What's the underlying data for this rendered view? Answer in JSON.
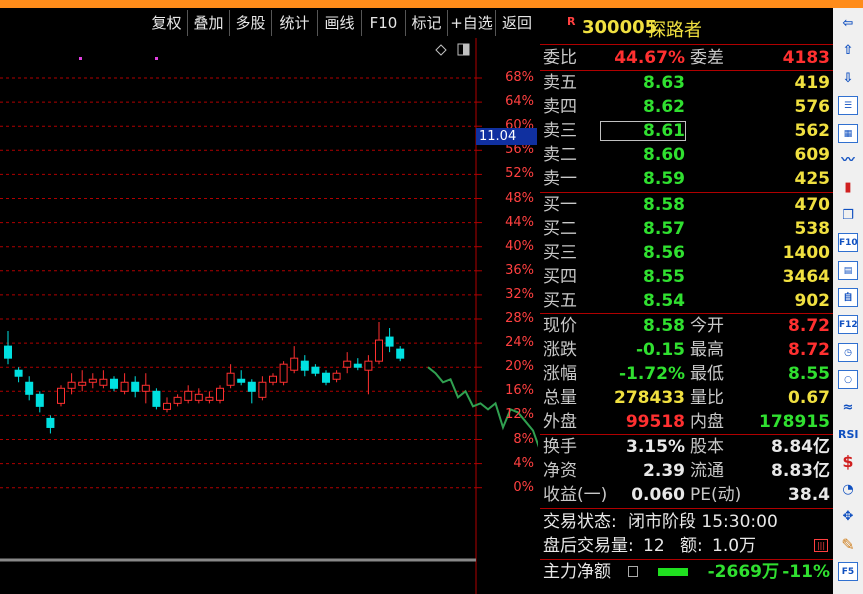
{
  "toolbar": {
    "buttons": [
      "复权",
      "叠加",
      "多股",
      "统计",
      "画线",
      "F10",
      "标记",
      "+自选",
      "返回"
    ]
  },
  "chart": {
    "axis_labels": [
      "68%",
      "64%",
      "60%",
      "56%",
      "52%",
      "48%",
      "44%",
      "40%",
      "36%",
      "32%",
      "28%",
      "24%",
      "20%",
      "16%",
      "12%",
      "8%",
      "4%",
      "0%"
    ],
    "price_tag": "11.04",
    "colors": {
      "up": "#ff3030",
      "down": "#00e0e0",
      "grid": "#b00000",
      "annotation": "#30a050"
    }
  },
  "chart_data": {
    "type": "candlestick",
    "title": "",
    "ylabel": "",
    "y_axis_unit": "percent",
    "ylim": [
      0,
      68
    ],
    "candles_pct": [
      {
        "o": 23.5,
        "c": 21.5,
        "h": 26.0,
        "l": 20.5
      },
      {
        "o": 19.5,
        "c": 18.5,
        "h": 20.0,
        "l": 17.5
      },
      {
        "o": 17.5,
        "c": 15.5,
        "h": 18.5,
        "l": 14.5
      },
      {
        "o": 15.5,
        "c": 13.5,
        "h": 16.0,
        "l": 12.5
      },
      {
        "o": 11.5,
        "c": 10.0,
        "h": 12.0,
        "l": 9.0
      },
      {
        "o": 14.0,
        "c": 16.5,
        "h": 17.0,
        "l": 13.5
      },
      {
        "o": 16.5,
        "c": 17.5,
        "h": 19.0,
        "l": 15.5
      },
      {
        "o": 17.0,
        "c": 17.5,
        "h": 19.5,
        "l": 16.0
      },
      {
        "o": 17.5,
        "c": 18.0,
        "h": 19.0,
        "l": 16.5
      },
      {
        "o": 17.0,
        "c": 18.0,
        "h": 19.5,
        "l": 16.5
      },
      {
        "o": 18.0,
        "c": 16.5,
        "h": 18.5,
        "l": 16.0
      },
      {
        "o": 16.0,
        "c": 17.5,
        "h": 19.0,
        "l": 15.5
      },
      {
        "o": 17.5,
        "c": 16.0,
        "h": 18.5,
        "l": 15.0
      },
      {
        "o": 16.0,
        "c": 17.0,
        "h": 19.0,
        "l": 14.0
      },
      {
        "o": 16.0,
        "c": 13.5,
        "h": 16.5,
        "l": 13.0
      },
      {
        "o": 13.0,
        "c": 14.0,
        "h": 15.0,
        "l": 12.5
      },
      {
        "o": 14.0,
        "c": 15.0,
        "h": 15.5,
        "l": 13.5
      },
      {
        "o": 14.5,
        "c": 16.0,
        "h": 17.0,
        "l": 14.0
      },
      {
        "o": 14.5,
        "c": 15.5,
        "h": 16.5,
        "l": 14.0
      },
      {
        "o": 14.5,
        "c": 15.0,
        "h": 16.0,
        "l": 14.0
      },
      {
        "o": 14.5,
        "c": 16.5,
        "h": 17.0,
        "l": 14.0
      },
      {
        "o": 17.0,
        "c": 19.0,
        "h": 20.5,
        "l": 16.5
      },
      {
        "o": 18.0,
        "c": 17.5,
        "h": 19.5,
        "l": 17.0
      },
      {
        "o": 17.5,
        "c": 16.0,
        "h": 18.0,
        "l": 14.0
      },
      {
        "o": 15.0,
        "c": 17.5,
        "h": 18.5,
        "l": 14.5
      },
      {
        "o": 17.5,
        "c": 18.5,
        "h": 19.0,
        "l": 17.0
      },
      {
        "o": 17.5,
        "c": 20.5,
        "h": 21.0,
        "l": 17.0
      },
      {
        "o": 19.5,
        "c": 21.5,
        "h": 23.5,
        "l": 19.0
      },
      {
        "o": 21.0,
        "c": 19.5,
        "h": 22.0,
        "l": 18.5
      },
      {
        "o": 20.0,
        "c": 19.0,
        "h": 20.5,
        "l": 18.5
      },
      {
        "o": 19.0,
        "c": 17.5,
        "h": 19.5,
        "l": 17.0
      },
      {
        "o": 18.0,
        "c": 19.0,
        "h": 19.5,
        "l": 17.5
      },
      {
        "o": 20.0,
        "c": 21.0,
        "h": 22.5,
        "l": 19.0
      },
      {
        "o": 20.5,
        "c": 20.0,
        "h": 21.5,
        "l": 19.5
      },
      {
        "o": 19.5,
        "c": 21.0,
        "h": 22.0,
        "l": 15.5
      },
      {
        "o": 21.0,
        "c": 24.5,
        "h": 27.5,
        "l": 20.5
      },
      {
        "o": 25.0,
        "c": 23.5,
        "h": 26.5,
        "l": 22.5
      },
      {
        "o": 23.0,
        "c": 21.5,
        "h": 23.5,
        "l": 21.0
      }
    ],
    "annotation_line_pct": [
      [
        20.0,
        0
      ],
      [
        19.0,
        1
      ],
      [
        17.5,
        2
      ],
      [
        18.0,
        3
      ],
      [
        15.0,
        4
      ],
      [
        16.0,
        5
      ],
      [
        13.5,
        6
      ],
      [
        14.0,
        7
      ],
      [
        13.0,
        8
      ],
      [
        14.0,
        9
      ],
      [
        10.0,
        10
      ],
      [
        13.0,
        11
      ],
      [
        12.5,
        12
      ],
      [
        11.0,
        13
      ],
      [
        9.5,
        14
      ],
      [
        6.0,
        15
      ],
      [
        4.5,
        16
      ],
      [
        3.0,
        17
      ],
      [
        1.5,
        18
      ],
      [
        0.0,
        19
      ]
    ]
  },
  "quote": {
    "code": "300005",
    "name": "探路者",
    "weibi_label": "委比",
    "weibi": "44.67%",
    "weicha_label": "委差",
    "weicha": "4183",
    "sell": [
      {
        "label": "卖五",
        "price": "8.63",
        "vol": "419"
      },
      {
        "label": "卖四",
        "price": "8.62",
        "vol": "576"
      },
      {
        "label": "卖三",
        "price": "8.61",
        "vol": "562"
      },
      {
        "label": "卖二",
        "price": "8.60",
        "vol": "609"
      },
      {
        "label": "卖一",
        "price": "8.59",
        "vol": "425"
      }
    ],
    "buy": [
      {
        "label": "买一",
        "price": "8.58",
        "vol": "470"
      },
      {
        "label": "买二",
        "price": "8.57",
        "vol": "538"
      },
      {
        "label": "买三",
        "price": "8.56",
        "vol": "1400"
      },
      {
        "label": "买四",
        "price": "8.55",
        "vol": "3464"
      },
      {
        "label": "买五",
        "price": "8.54",
        "vol": "902"
      }
    ],
    "stats": [
      {
        "l1": "现价",
        "v1": "8.58",
        "c1": "green",
        "l2": "今开",
        "v2": "8.72",
        "c2": "red"
      },
      {
        "l1": "涨跌",
        "v1": "-0.15",
        "c1": "green",
        "l2": "最高",
        "v2": "8.72",
        "c2": "red"
      },
      {
        "l1": "涨幅",
        "v1": "-1.72%",
        "c1": "green",
        "l2": "最低",
        "v2": "8.55",
        "c2": "green"
      },
      {
        "l1": "总量",
        "v1": "278433",
        "c1": "yellow",
        "l2": "量比",
        "v2": "0.67",
        "c2": "yellow"
      },
      {
        "l1": "外盘",
        "v1": "99518",
        "c1": "red",
        "l2": "内盘",
        "v2": "178915",
        "c2": "green"
      }
    ],
    "stats2": [
      {
        "l1": "换手",
        "v1": "3.15%",
        "l2": "股本",
        "v2": "8.84亿"
      },
      {
        "l1": "净资",
        "v1": "2.39",
        "l2": "流通",
        "v2": "8.83亿"
      },
      {
        "l1": "收益(一)",
        "v1": "0.060",
        "l2": "PE(动)",
        "v2": "38.4"
      }
    ],
    "trade_status_label": "交易状态:",
    "trade_status": "闭市阶段 15:30:00",
    "after_hours_label": "盘后交易量:",
    "after_hours_vol": "12",
    "amount_label": "额:",
    "amount": "1.0万",
    "main_flow_label": "主力净额",
    "main_flow": "-2669万",
    "main_flow_pct": "-11%"
  },
  "sidebar": {
    "icons": [
      "arrow-left-icon",
      "arrow-up-icon",
      "arrow-down-icon",
      "list-icon",
      "grid-icon",
      "line-chart-icon",
      "candle-chart-icon",
      "window-icon",
      "f10-icon",
      "book-icon",
      "self-select-icon",
      "f12-icon",
      "clock-icon",
      "circle-icon",
      "wave-icon",
      "rsi-icon",
      "money-icon",
      "pie-icon",
      "move-icon",
      "pen-icon",
      "f5-icon"
    ],
    "labels": {
      "f10-icon": "F10",
      "self-select-icon": "自",
      "f12-icon": "F12",
      "rsi-icon": "RSI",
      "money-icon": "$",
      "f5-icon": "F5"
    }
  }
}
